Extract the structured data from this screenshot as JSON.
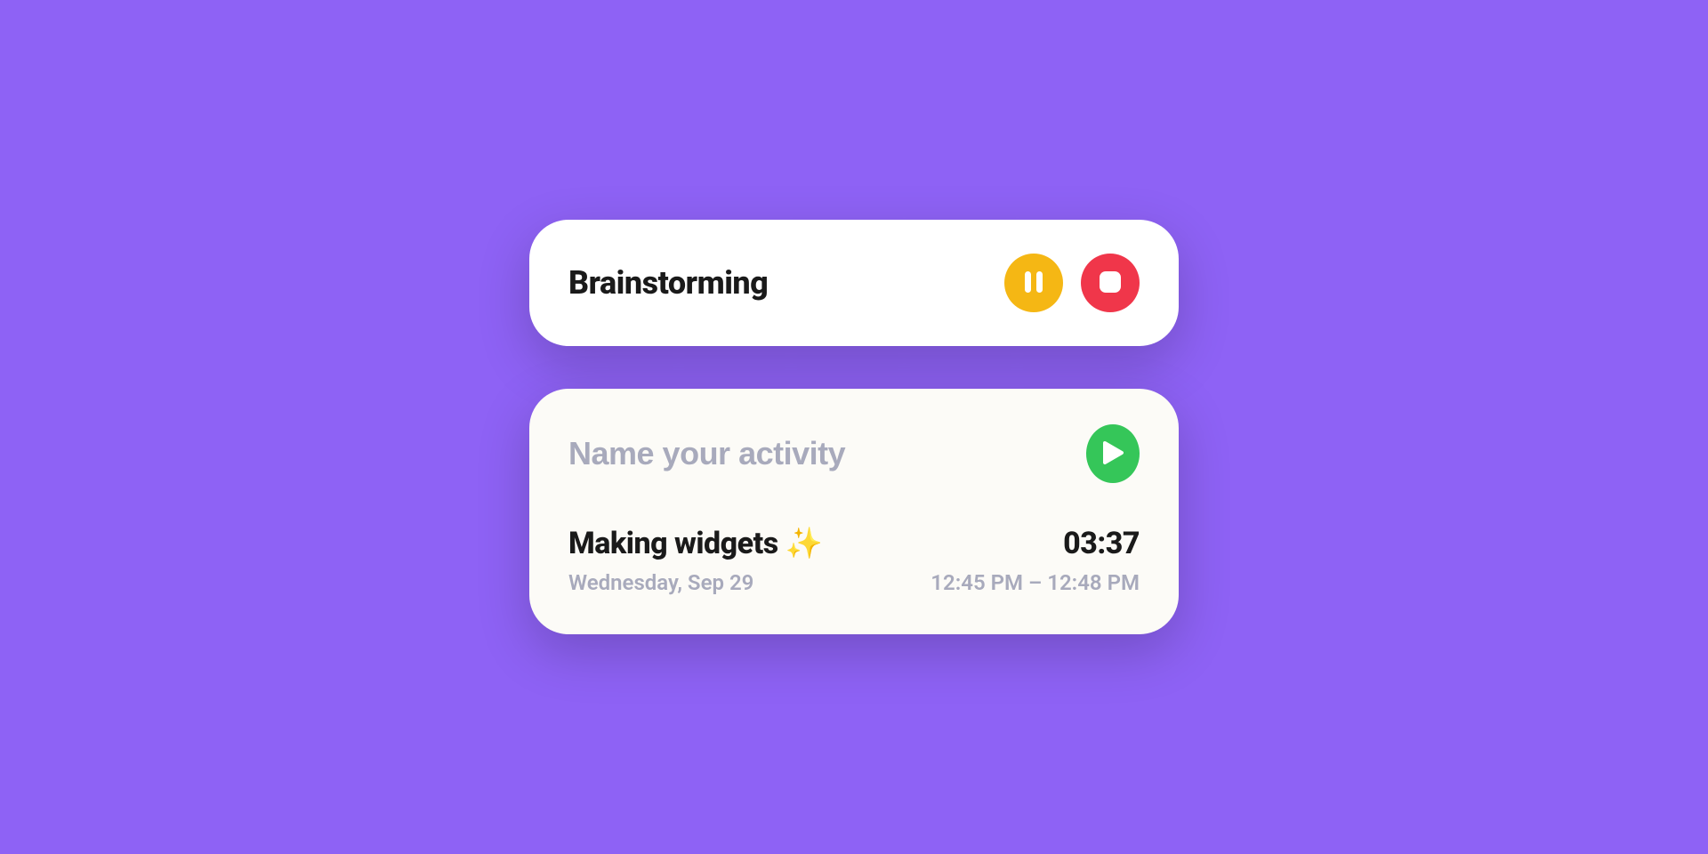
{
  "tracker": {
    "current_activity": "Brainstorming"
  },
  "new_entry": {
    "placeholder": "Name your activity"
  },
  "recent_entry": {
    "title": "Making widgets ✨",
    "date": "Wednesday, Sep 29",
    "duration": "03:37",
    "time_range": "12:45 PM – 12:48 PM"
  }
}
